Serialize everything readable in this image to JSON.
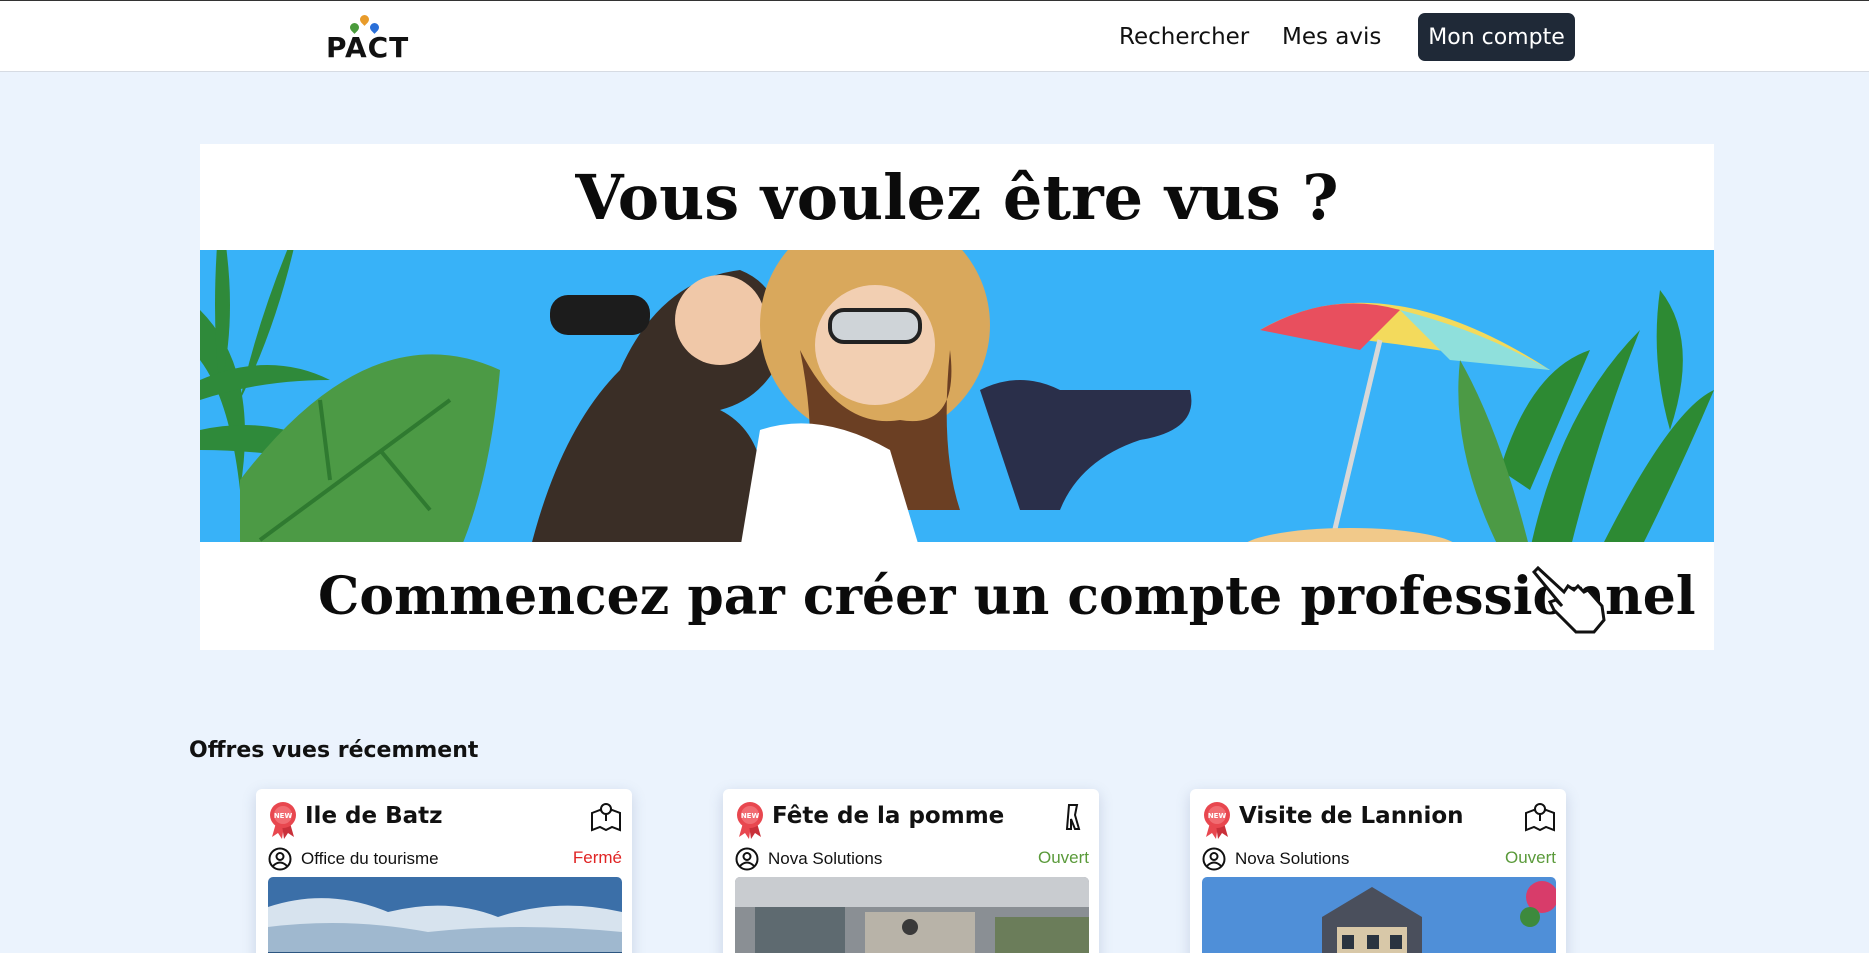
{
  "header": {
    "logo_text": "PACT",
    "nav": {
      "search": "Rechercher",
      "reviews": "Mes avis",
      "account": "Mon compte"
    }
  },
  "banner": {
    "headline": "Vous voulez être vus ?",
    "cta": "Commencez par créer un compte professionnel !"
  },
  "recent": {
    "title": "Offres vues récemment",
    "offers": [
      {
        "title": "Ile de Batz",
        "owner": "Office du tourisme",
        "status": "Fermé",
        "status_color": "#e02424",
        "badge": "NEW",
        "type_icon": "map-icon"
      },
      {
        "title": "Fête de la pomme",
        "owner": "Nova Solutions",
        "status": "Ouvert",
        "status_color": "#5a9a3a",
        "badge": "NEW",
        "type_icon": "show-icon"
      },
      {
        "title": "Visite de Lannion",
        "owner": "Nova Solutions",
        "status": "Ouvert",
        "status_color": "#5a9a3a",
        "badge": "NEW",
        "type_icon": "map-icon"
      }
    ]
  },
  "colors": {
    "page_bg": "#ebf3fd",
    "account_button": "#1f2937",
    "banner_sky": "#38b2f8"
  }
}
